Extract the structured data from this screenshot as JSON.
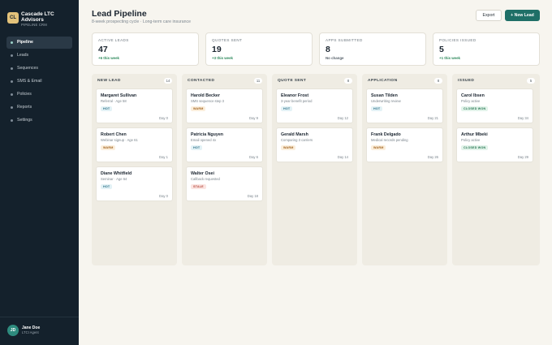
{
  "brand": {
    "logo": "CL",
    "name": "Cascade LTC Advisors",
    "subtitle": "PIPELINE CRM"
  },
  "nav": [
    {
      "label": "Pipeline",
      "active": true
    },
    {
      "label": "Leads",
      "active": false
    },
    {
      "label": "Sequences",
      "active": false
    },
    {
      "label": "SMS & Email",
      "active": false
    },
    {
      "label": "Policies",
      "active": false
    },
    {
      "label": "Reports",
      "active": false
    },
    {
      "label": "Settings",
      "active": false
    }
  ],
  "user": {
    "initials": "JD",
    "name": "Jane Doe",
    "role": "LTCI Agent"
  },
  "header": {
    "title": "Lead Pipeline",
    "subtitle": "8-week prospecting cycle · Long-term care insurance",
    "export_label": "Export",
    "new_lead_label": "+ New Lead"
  },
  "stats": [
    {
      "label": "Active Leads",
      "value": "47",
      "change": "+6 this week",
      "tone": "positive"
    },
    {
      "label": "Quotes Sent",
      "value": "19",
      "change": "+3 this week",
      "tone": "positive"
    },
    {
      "label": "Apps Submitted",
      "value": "8",
      "change": "No change",
      "tone": "neutral"
    },
    {
      "label": "Policies Issued",
      "value": "5",
      "change": "+1 this week",
      "tone": "positive"
    }
  ],
  "columns": [
    {
      "title": "New Lead",
      "count": "14",
      "cards": [
        {
          "name": "Margaret Sullivan",
          "meta": "Referral · Age 58",
          "tag": "HOT",
          "tag_type": "hot",
          "day": "Day 0"
        },
        {
          "name": "Robert Chen",
          "meta": "Webinar signup · Age 61",
          "tag": "WARM",
          "tag_type": "warm",
          "day": "Day 1"
        },
        {
          "name": "Diane Whitfield",
          "meta": "Seminar · Age 64",
          "tag": "HOT",
          "tag_type": "hot",
          "day": "Day 0"
        }
      ]
    },
    {
      "title": "Contacted",
      "count": "11",
      "cards": [
        {
          "name": "Harold Becker",
          "meta": "SMS sequence step 3",
          "tag": "WARM",
          "tag_type": "warm",
          "day": "Day 9"
        },
        {
          "name": "Patricia Nguyen",
          "meta": "Email opened 4x",
          "tag": "HOT",
          "tag_type": "hot",
          "day": "Day 6"
        },
        {
          "name": "Walter Osei",
          "meta": "Callback requested",
          "tag": "STALE",
          "tag_type": "stale",
          "day": "Day 18"
        }
      ]
    },
    {
      "title": "Quote Sent",
      "count": "8",
      "cards": [
        {
          "name": "Eleanor Frost",
          "meta": "3-year benefit period",
          "tag": "HOT",
          "tag_type": "hot",
          "day": "Day 12"
        },
        {
          "name": "Gerald Marsh",
          "meta": "Comparing 3 carriers",
          "tag": "WARM",
          "tag_type": "warm",
          "day": "Day 14"
        }
      ]
    },
    {
      "title": "Application",
      "count": "8",
      "cards": [
        {
          "name": "Susan Tilden",
          "meta": "Underwriting review",
          "tag": "HOT",
          "tag_type": "hot",
          "day": "Day 21"
        },
        {
          "name": "Frank Delgado",
          "meta": "Medical records pending",
          "tag": "WARM",
          "tag_type": "warm",
          "day": "Day 26"
        }
      ]
    },
    {
      "title": "Issued",
      "count": "5",
      "cards": [
        {
          "name": "Carol Ibsen",
          "meta": "Policy active",
          "tag": "CLOSED WON",
          "tag_type": "won",
          "day": "Day 34"
        },
        {
          "name": "Arthur Mbeki",
          "meta": "Policy active",
          "tag": "CLOSED WON",
          "tag_type": "won",
          "day": "Day 29"
        }
      ]
    }
  ]
}
